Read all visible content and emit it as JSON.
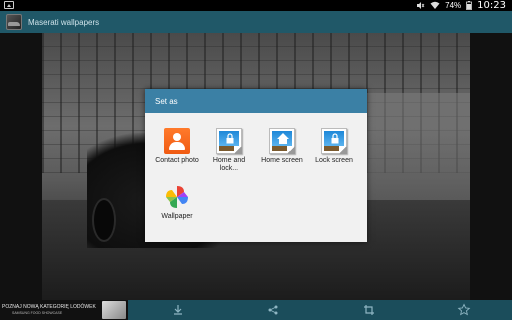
{
  "status_bar": {
    "battery_percent": "74%",
    "time": "10:23"
  },
  "action_bar": {
    "title": "Maserati wallpapers"
  },
  "dialog": {
    "title": "Set as",
    "options": [
      {
        "label": "Contact photo",
        "icon": "contact-icon"
      },
      {
        "label": "Home and lock...",
        "icon": "lock-screen-icon"
      },
      {
        "label": "Home screen",
        "icon": "home-screen-icon"
      },
      {
        "label": "Lock screen",
        "icon": "lock-screen-icon"
      },
      {
        "label": "Wallpaper",
        "icon": "pinwheel-icon"
      }
    ]
  },
  "ad_banner": {
    "line1": "POZNAJ NOWĄ KATEGORIĘ LODÓWEK",
    "line2": "SAMSUNG FOOD SHOWCASE"
  },
  "bottom_bar": {
    "buttons": [
      "download-icon",
      "share-icon",
      "crop-icon",
      "favorite-icon"
    ]
  },
  "colors": {
    "action_bar": "#205868",
    "dialog_header": "#3b80a5",
    "bottom_bar": "#1b4d5b"
  }
}
